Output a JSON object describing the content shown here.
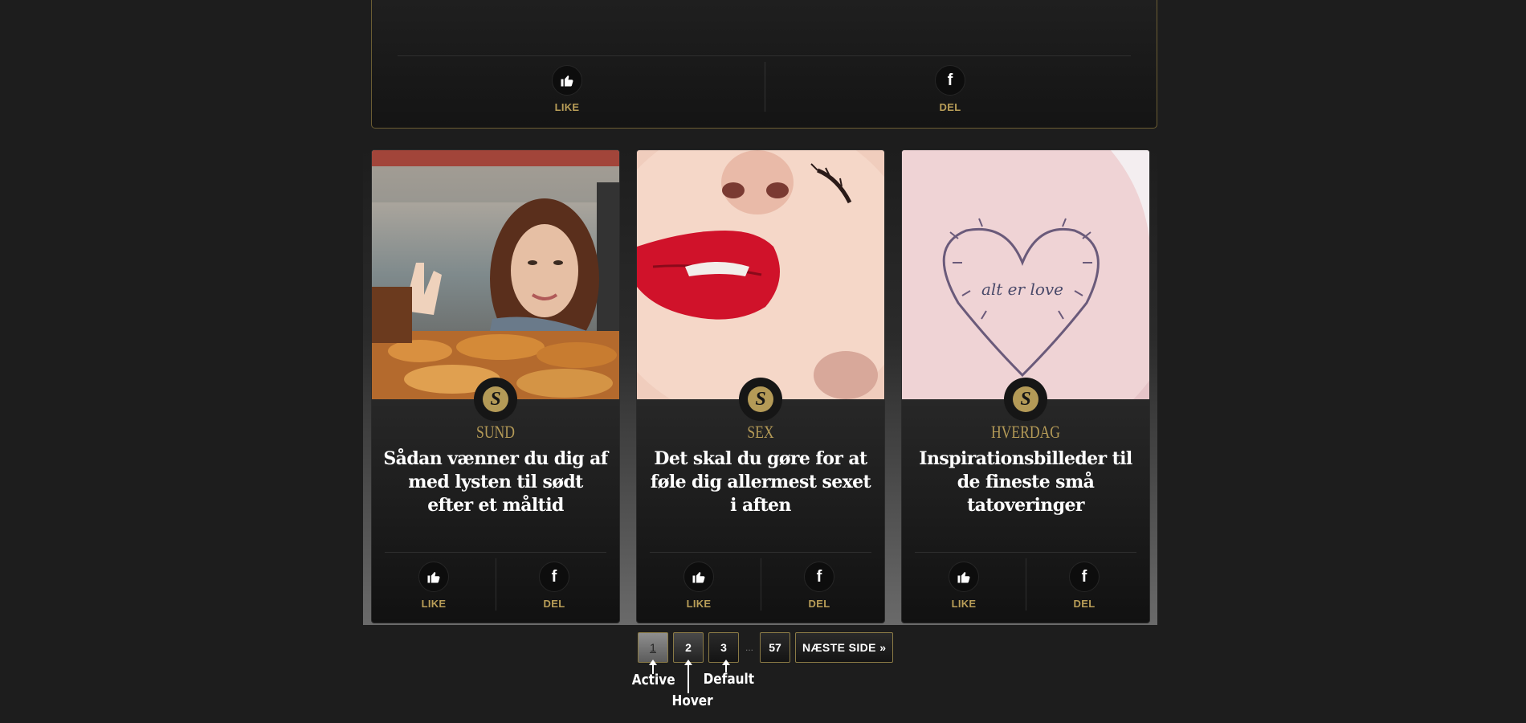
{
  "top_card": {
    "like_label": "LIKE",
    "share_label": "DEL"
  },
  "cards": [
    {
      "category": "SUND",
      "title": "Sådan vænner du dig af med lysten til sødt efter et måltid",
      "like_label": "LIKE",
      "share_label": "DEL",
      "badge": "S"
    },
    {
      "category": "SEX",
      "title": "Det skal du gøre for at føle dig allermest sexet i aften",
      "like_label": "LIKE",
      "share_label": "DEL",
      "badge": "S"
    },
    {
      "category": "HVERDAG",
      "title": "Inspirationsbilleder til de fineste små tatoveringer",
      "like_label": "LIKE",
      "share_label": "DEL",
      "badge": "S",
      "tattoo_text": "alt er love"
    }
  ],
  "pagination": {
    "pages": [
      "1",
      "2",
      "3"
    ],
    "ellipsis": "...",
    "last": "57",
    "next_label": "NÆSTE SIDE »",
    "active_page": "1"
  },
  "annotations": {
    "active": "Active",
    "hover": "Hover",
    "default": "Default"
  },
  "colors": {
    "accent_gold": "#b49a57",
    "background": "#1d1d1d"
  },
  "icons": [
    "thumbs-up-icon",
    "facebook-icon",
    "brand-s-logo"
  ]
}
